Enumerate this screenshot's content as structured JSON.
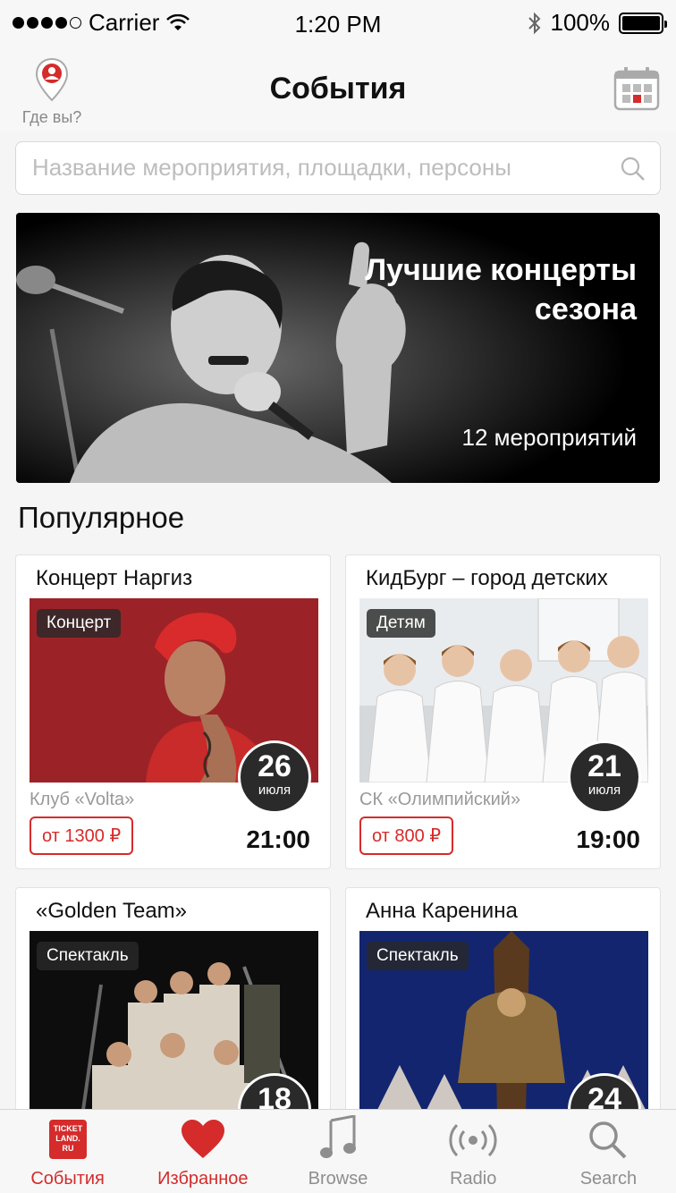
{
  "status_bar": {
    "carrier": "Carrier",
    "time": "1:20 PM",
    "battery": "100%"
  },
  "nav": {
    "location_label": "Где вы?",
    "title": "События"
  },
  "search": {
    "placeholder": "Название мероприятия, площадки, персоны"
  },
  "banner": {
    "title_line1": "Лучшие концерты",
    "title_line2": "сезона",
    "count": "12 мероприятий"
  },
  "section": {
    "title": "Популярное"
  },
  "events": [
    {
      "title": "Концерт Наргиз",
      "tag": "Концерт",
      "day": "26",
      "month": "июля",
      "venue": "Клуб «Volta»",
      "price": "от 1300 ₽",
      "time": "21:00"
    },
    {
      "title": "КидБург – город детских",
      "tag": "Детям",
      "day": "21",
      "month": "июля",
      "venue": "СК «Олимпийский»",
      "price": "от 800 ₽",
      "time": "19:00"
    },
    {
      "title": "«Golden Team»",
      "tag": "Спектакль",
      "day": "18",
      "month": ""
    },
    {
      "title": "Анна Каренина",
      "tag": "Спектакль",
      "day": "24",
      "month": ""
    }
  ],
  "tabs": [
    {
      "label": "События",
      "icon": "ticketland-logo-icon",
      "logo_text": "TICKET LAND. RU"
    },
    {
      "label": "Избранное",
      "icon": "heart-icon"
    },
    {
      "label": "Browse",
      "icon": "music-note-icon"
    },
    {
      "label": "Radio",
      "icon": "radio-icon"
    },
    {
      "label": "Search",
      "icon": "search-icon"
    }
  ],
  "colors": {
    "accent": "#d52b2b",
    "text": "#111111",
    "muted": "#8e8e8e"
  }
}
